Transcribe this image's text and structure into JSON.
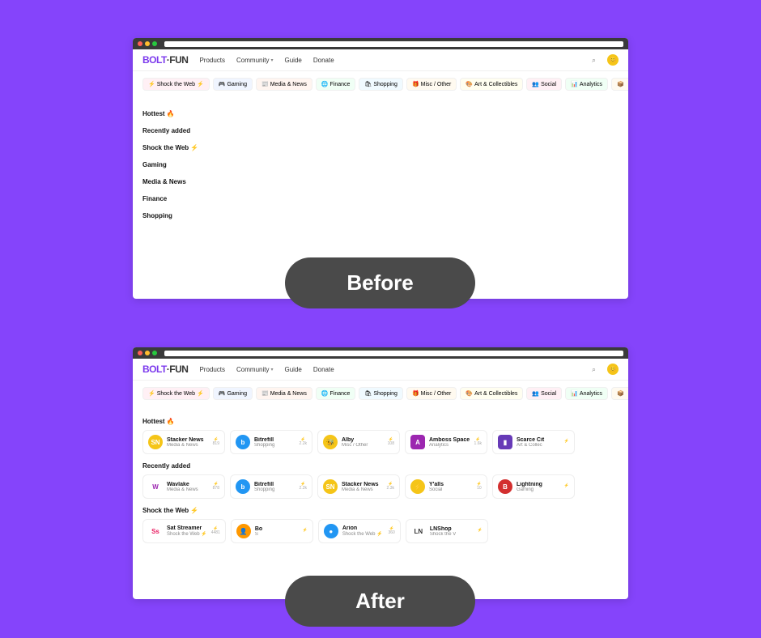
{
  "labels": {
    "before": "Before",
    "after": "After"
  },
  "logo": {
    "part1": "BOLT",
    "part2": "·FUN"
  },
  "nav": [
    {
      "label": "Products"
    },
    {
      "label": "Community",
      "dropdown": true
    },
    {
      "label": "Guide"
    },
    {
      "label": "Donate"
    }
  ],
  "chips": [
    {
      "icon": "⚡",
      "label": "Shock the Web ⚡",
      "cls": "pink"
    },
    {
      "icon": "🎮",
      "label": "Gaming",
      "cls": "blue"
    },
    {
      "icon": "📰",
      "label": "Media & News",
      "cls": "red"
    },
    {
      "icon": "🌐",
      "label": "Finance",
      "cls": "green"
    },
    {
      "icon": "🛍",
      "label": "Shopping",
      "cls": "cyan"
    },
    {
      "icon": "🎁",
      "label": "Misc / Other",
      "cls": "orange"
    },
    {
      "icon": "🎨",
      "label": "Art & Collectibles",
      "cls": "yellow"
    },
    {
      "icon": "👥",
      "label": "Social",
      "cls": "pink"
    },
    {
      "icon": "📊",
      "label": "Analytics",
      "cls": "green"
    },
    {
      "icon": "📦",
      "label": "",
      "cls": "orange"
    }
  ],
  "before_sections": [
    "Hottest 🔥",
    "Recently added",
    "Shock the Web ⚡",
    "Gaming",
    "Media & News",
    "Finance",
    "Shopping"
  ],
  "after_sections": [
    {
      "title": "Hottest 🔥",
      "items": [
        {
          "name": "Stacker News",
          "cat": "Media & News",
          "bg": "#f5c518",
          "ic": "SN",
          "stat": "819"
        },
        {
          "name": "Bitrefill",
          "cat": "Shopping",
          "bg": "#2196f3",
          "ic": "b",
          "stat": "2.2k"
        },
        {
          "name": "Alby",
          "cat": "Misc / Other",
          "bg": "#f5c518",
          "ic": "🐝",
          "stat": "108"
        },
        {
          "name": "Amboss Space",
          "cat": "Analytics",
          "bg": "#9c27b0",
          "ic": "A",
          "rect": true,
          "stat": "1.6k"
        },
        {
          "name": "Scarce Cit",
          "cat": "Art & Collec",
          "bg": "#673ab7",
          "ic": "▮",
          "rect": true,
          "stat": ""
        }
      ]
    },
    {
      "title": "Recently added",
      "items": [
        {
          "name": "Wavlake",
          "cat": "Media & News",
          "bg": "#fff",
          "ic": "W",
          "fg": "#9c27b0",
          "stat": "878"
        },
        {
          "name": "Bitrefill",
          "cat": "Shopping",
          "bg": "#2196f3",
          "ic": "b",
          "stat": "2.2k"
        },
        {
          "name": "Stacker News",
          "cat": "Media & News",
          "bg": "#f5c518",
          "ic": "SN",
          "stat": "2.3k"
        },
        {
          "name": "Y'alls",
          "cat": "Social",
          "bg": "#f5c518",
          "ic": "⚡",
          "stat": "10"
        },
        {
          "name": "Lightning",
          "cat": "Gaming",
          "bg": "#d32f2f",
          "ic": "B",
          "stat": ""
        }
      ]
    },
    {
      "title": "Shock the Web ⚡",
      "items": [
        {
          "name": "Sat Streamer",
          "cat": "Shock the Web ⚡",
          "bg": "#fff",
          "ic": "Ss",
          "fg": "#e91e63",
          "rect": true,
          "stat": "4481"
        },
        {
          "name": "Bo",
          "cat": "S",
          "bg": "#ff9800",
          "ic": "👤",
          "stat": ""
        },
        {
          "name": "Arion",
          "cat": "Shock the Web ⚡",
          "bg": "#2196f3",
          "ic": "●",
          "stat": "360"
        },
        {
          "name": "LNShop",
          "cat": "Shock the V",
          "bg": "#fff",
          "ic": "LN",
          "fg": "#333",
          "rect": true,
          "stat": ""
        }
      ]
    }
  ]
}
